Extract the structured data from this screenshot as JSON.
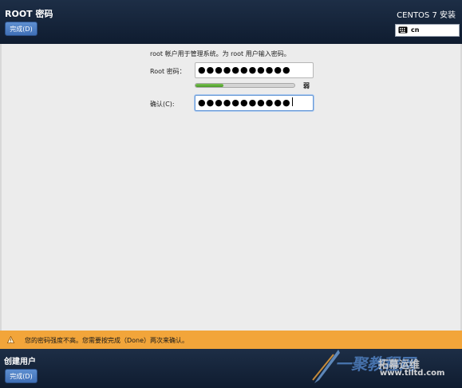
{
  "header": {
    "title": "ROOT 密码",
    "done_label": "完成(D)",
    "product": "CENTOS 7 安装",
    "keyboard_layout": "cn"
  },
  "form": {
    "description": "root 帐户用于管理系统。为 root 用户输入密码。",
    "password_label": "Root 密码：",
    "password_value": "●●●●●●●●●●●",
    "strength_level": 0.28,
    "strength_label": "弱",
    "confirm_label": "确认(C):",
    "confirm_value": "●●●●●●●●●●●"
  },
  "warning": {
    "message": "您的密码强度不高。您需要按完成（Done）两次来确认。",
    "color": "#f2a53a"
  },
  "footer": {
    "title": "创建用户",
    "done_label": "完成(D)"
  },
  "watermark": {
    "line1": "一聚教程网",
    "line2": "拓幕运维",
    "line3": "www.tlltd.com"
  },
  "colors": {
    "header_bg": "#1d2e46",
    "button_blue": "#4f7fc4",
    "strength_green": "#5aab37"
  }
}
